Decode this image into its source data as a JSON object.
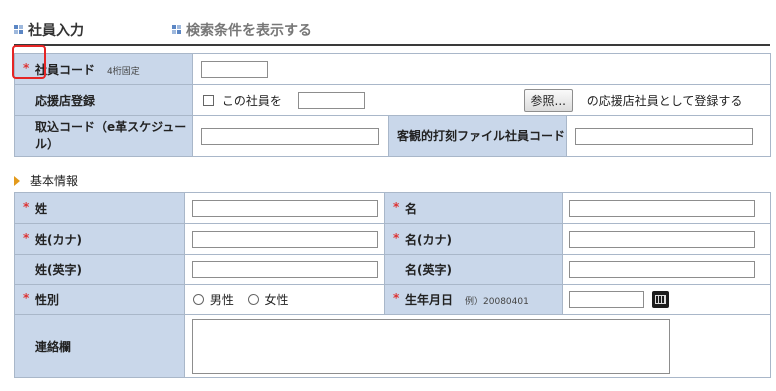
{
  "header": {
    "title": "社員入力",
    "show_conditions_link": "検索条件を表示する"
  },
  "top_form": {
    "employee_code": {
      "label": "社員コード",
      "hint": "4桁固定",
      "value": ""
    },
    "agency_registration": {
      "label": "応援店登録",
      "checkbox_text": "この社員を",
      "input_value": "",
      "ref_button": "参照...",
      "suffix_text": "の応援店社員として登録する"
    },
    "import_code": {
      "label": "取込コード（e革スケジュール）",
      "value": ""
    },
    "objective_file": {
      "label": "客観的打刻ファイル社員コード",
      "value": ""
    }
  },
  "basic_info": {
    "section_title": "基本情報",
    "last_name": {
      "label": "姓",
      "value": ""
    },
    "first_name": {
      "label": "名",
      "value": ""
    },
    "last_name_kana": {
      "label": "姓(カナ)",
      "value": ""
    },
    "first_name_kana": {
      "label": "名(カナ)",
      "value": ""
    },
    "last_name_en": {
      "label": "姓(英字)",
      "value": ""
    },
    "first_name_en": {
      "label": "名(英字)",
      "value": ""
    },
    "gender": {
      "label": "性別",
      "male": "男性",
      "female": "女性"
    },
    "birthdate": {
      "label": "生年月日",
      "hint": "例）20080401",
      "value": ""
    },
    "notes": {
      "label": "連絡欄",
      "value": ""
    }
  },
  "required_mark": "*",
  "colors": {
    "label_bg": "#c9d7ea",
    "required": "#dd3333",
    "highlight": "#e52525"
  }
}
